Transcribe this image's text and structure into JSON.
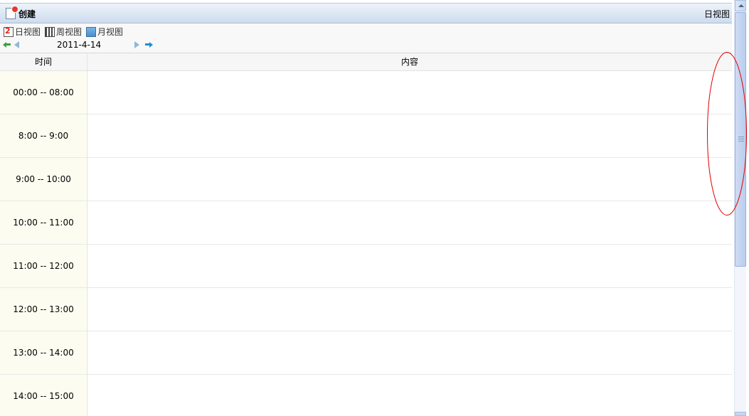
{
  "titlebar": {
    "create_label": "创建",
    "view_name": "日视图"
  },
  "toolbar": {
    "views": [
      {
        "label": "日视图",
        "icon": "day-view-icon"
      },
      {
        "label": "周视图",
        "icon": "week-view-icon"
      },
      {
        "label": "月视图",
        "icon": "month-view-icon"
      }
    ],
    "date": "2011-4-14"
  },
  "grid": {
    "columns": [
      "时间",
      "内容"
    ],
    "rows": [
      {
        "time": "00:00 -- 08:00",
        "content": ""
      },
      {
        "time": "8:00 -- 9:00",
        "content": ""
      },
      {
        "time": "9:00 -- 10:00",
        "content": ""
      },
      {
        "time": "10:00 -- 11:00",
        "content": ""
      },
      {
        "time": "11:00 -- 12:00",
        "content": ""
      },
      {
        "time": "12:00 -- 13:00",
        "content": ""
      },
      {
        "time": "13:00 -- 14:00",
        "content": ""
      },
      {
        "time": "14:00 -- 15:00",
        "content": ""
      }
    ]
  },
  "colors": {
    "annotation": "#e00000",
    "time_cell_bg": "#fcfdf0",
    "titlebar_bg": "#cddcef"
  }
}
